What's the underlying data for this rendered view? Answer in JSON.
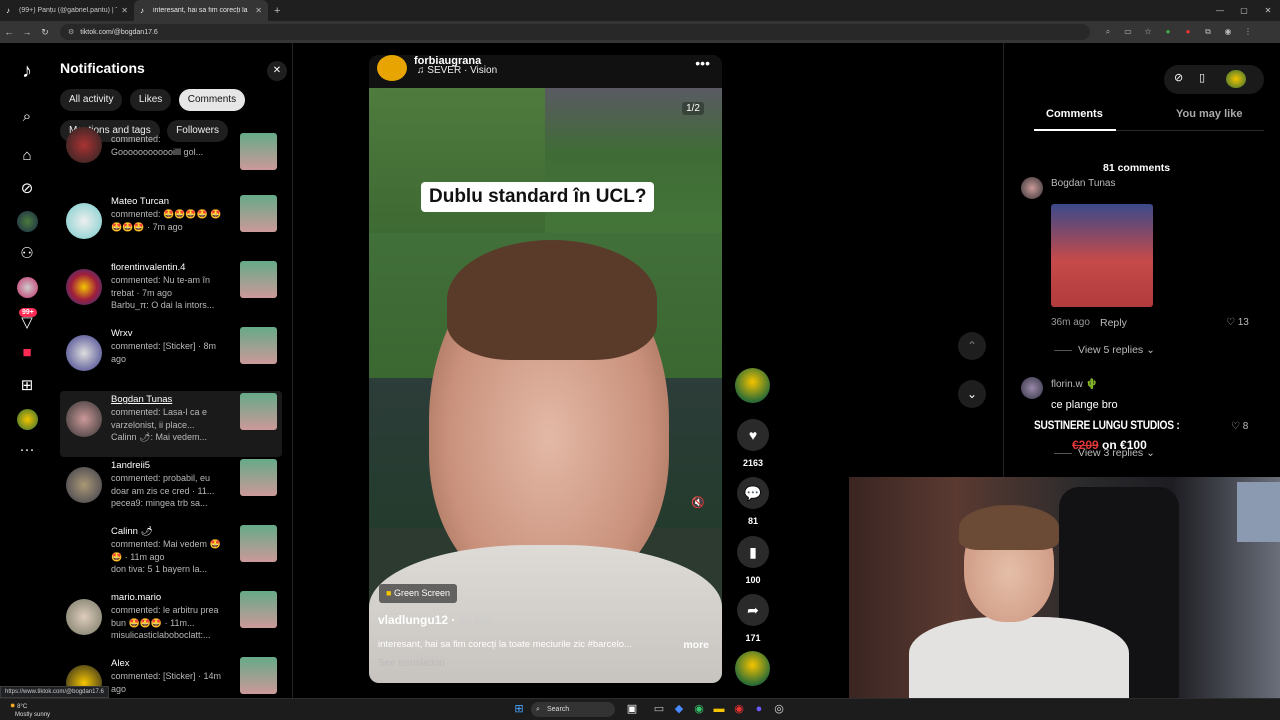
{
  "browser": {
    "tabs": [
      {
        "title": "(99+) Panțu (@gabriel.pantu) | T",
        "active": false
      },
      {
        "title": "interesant, hai sa fim corecți la",
        "active": true
      }
    ],
    "url": "tiktok.com/@bogdan17.6",
    "status_url": "https://www.tiktok.com/@bogdan17.6"
  },
  "notifications": {
    "title": "Notifications",
    "filters": [
      "All activity",
      "Likes",
      "Comments",
      "Mentions and tags",
      "Followers"
    ],
    "active_filter": "Comments",
    "items": [
      {
        "name": "",
        "text": "commented: Goooooooooooilll gol..."
      },
      {
        "name": "Mateo Turcan",
        "text": "commented: 🤩🤩🤩🤩 🤩🤩🤩🤩 · 7m ago"
      },
      {
        "name": "florentinvalentin.4",
        "text": "commented: Nu te-am în trebat · 7m ago",
        "sub": "Barbu_π: O dai la intors..."
      },
      {
        "name": "Wrxv",
        "text": "commented: [Sticker] · 8m ago"
      },
      {
        "name": "Bogdan Tunas",
        "text": "commented: Lasa-l ca e varzelonist, ii place...",
        "sub": "Calinn 🌶: Mai vedem..."
      },
      {
        "name": "1andreii5",
        "text": "commented: probabil, eu doar am zis ce cred · 11...",
        "sub": "pecea9: mingea trb sa..."
      },
      {
        "name": "Calinn 🌶",
        "text": "commented: Mai vedem 🤩🤩 · 11m ago",
        "sub": "don tiva: 5 1 bayern la..."
      },
      {
        "name": "mario.mario",
        "text": "commented: le arbitru prea bun 🤩🤩🤩 · 11m...",
        "sub": "misulicasticlaboboclatt:..."
      },
      {
        "name": "Alex",
        "text": "commented: [Sticker] · 14m ago"
      }
    ]
  },
  "video": {
    "account": "forbiaugrana",
    "music": "SEVER · Vision",
    "counter": "1/2",
    "caption": "Dublu standard în UCL?",
    "effect": "Green Screen",
    "author": "vladlungu12",
    "time": "1h ago",
    "description": "interesant, hai sa fim corecți la toate meciurile zic #barcelo...",
    "more": "more",
    "translate": "See translation",
    "likes": "2163",
    "comments": "81",
    "saves": "100",
    "shares": "171"
  },
  "comments": {
    "tabs": [
      "Comments",
      "You may like"
    ],
    "count": "81 comments",
    "items": [
      {
        "name": "Bogdan Tunas",
        "time": "36m ago",
        "reply": "Reply",
        "likes": "13",
        "view_replies": "View 5 replies"
      },
      {
        "name": "florin.w 🌵",
        "text": "ce plange bro",
        "likes": "8",
        "view_replies": "View 3 replies"
      }
    ],
    "promo_title": "SUSTINERE LUNGU STUDIOS :",
    "promo_old": "€209",
    "promo_new": "on €100"
  },
  "taskbar": {
    "weather_temp": "8°C",
    "weather_desc": "Mostly sunny",
    "search": "Search"
  },
  "colors": {
    "accent": "#fe2c55",
    "background": "#000000"
  }
}
